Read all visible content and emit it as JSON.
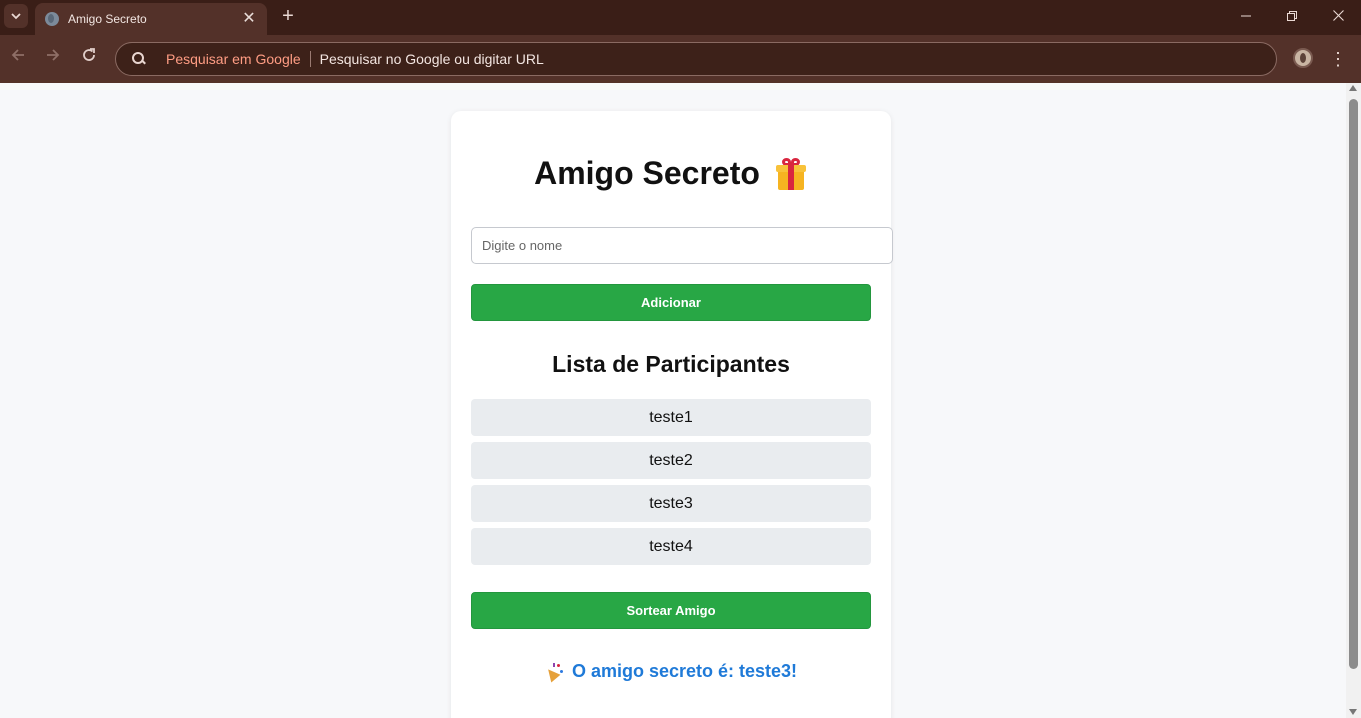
{
  "browser": {
    "tab_title": "Amigo Secreto",
    "new_tab_symbol": "+",
    "omnibox_engine": "Pesquisar em Google",
    "omnibox_placeholder": "Pesquisar no Google ou digitar URL",
    "window_controls": [
      "minimize-icon",
      "restore-icon",
      "close-icon"
    ]
  },
  "app": {
    "title": "Amigo Secreto",
    "title_icon": "gift-icon",
    "input_placeholder": "Digite o nome",
    "input_value": "",
    "add_button": "Adicionar",
    "list_heading": "Lista de Participantes",
    "participants": [
      "teste1",
      "teste2",
      "teste3",
      "teste4"
    ],
    "draw_button": "Sortear Amigo",
    "result_icon": "party-popper-icon",
    "result": "O amigo secreto é: teste3!"
  },
  "colors": {
    "accent_green": "#28a745",
    "result_blue": "#1f7ad8",
    "list_item_bg": "#e9ecef",
    "browser_frame": "#533129"
  }
}
